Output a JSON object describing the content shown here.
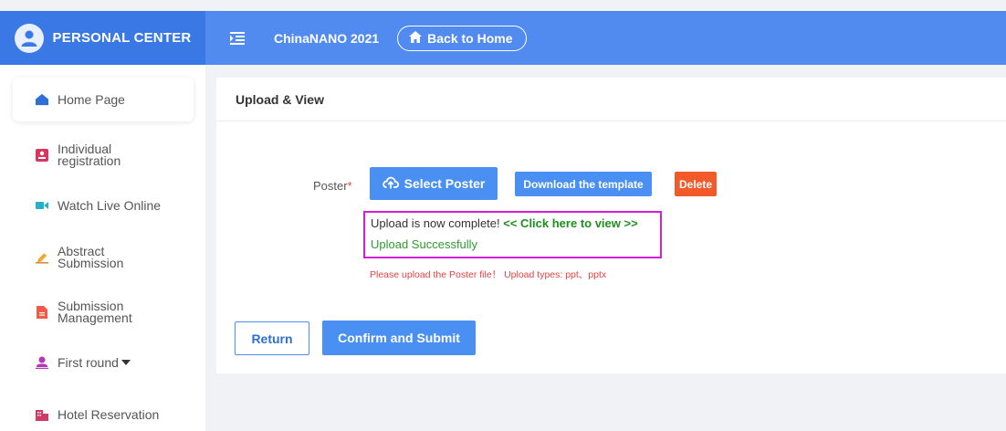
{
  "header": {
    "brand_label": "PERSONAL CENTER",
    "conference_title": "ChinaNANO 2021",
    "back_home_label": "Back to Home"
  },
  "sidebar": {
    "items": [
      {
        "label": "Home Page",
        "icon": "home-icon",
        "active": true
      },
      {
        "label": "Individual\nregistration",
        "icon": "id-card-icon"
      },
      {
        "label": "Watch Live Online",
        "icon": "video-icon"
      },
      {
        "label": "Abstract\nSubmission",
        "icon": "pen-icon"
      },
      {
        "label": "Submission\nManagement",
        "icon": "document-icon"
      },
      {
        "label": "First round",
        "icon": "user-icon",
        "has_dropdown": true
      },
      {
        "label": "Hotel Reservation",
        "icon": "hotel-icon"
      }
    ]
  },
  "main": {
    "panel_title": "Upload & View",
    "poster_label": "Poster",
    "required_mark": "*",
    "select_button": "Select Poster",
    "template_button": "Download the template",
    "delete_button": "Delete",
    "upload_complete_text": "Upload is now complete!",
    "view_link_text": "<< Click here to view >>",
    "upload_success_text": "Upload Successfully",
    "upload_hint": "Please upload the Poster file！ Upload types: ppt、pptx",
    "return_button": "Return",
    "submit_button": "Confirm and Submit"
  },
  "colors": {
    "brand_bar": "#3a78e6",
    "nav_bar": "#528bf0",
    "primary_button": "#4a90f2",
    "danger_button": "#f25a2b",
    "highlight_border": "#d41fd9",
    "success_text": "#2e9b2e",
    "error_text": "#e64242"
  }
}
